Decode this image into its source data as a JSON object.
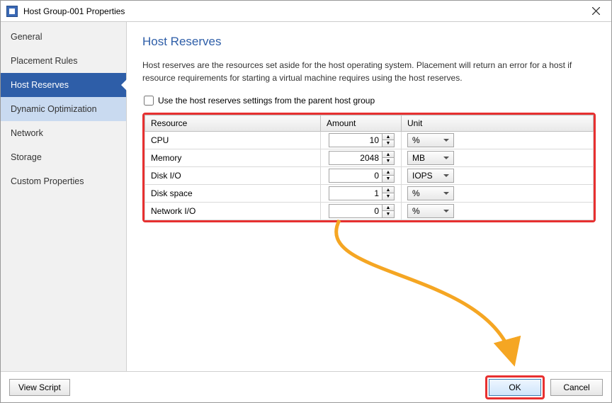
{
  "window": {
    "title": "Host Group-001 Properties"
  },
  "sidebar": {
    "items": [
      {
        "label": "General"
      },
      {
        "label": "Placement Rules"
      },
      {
        "label": "Host Reserves"
      },
      {
        "label": "Dynamic Optimization"
      },
      {
        "label": "Network"
      },
      {
        "label": "Storage"
      },
      {
        "label": "Custom Properties"
      }
    ],
    "selected_index": 2,
    "highlight_index": 3
  },
  "page": {
    "title": "Host Reserves",
    "description": "Host reserves are the resources set aside for the host operating system.  Placement will return an error for a host if resource requirements for starting a virtual machine requires using the host reserves.",
    "checkbox_label": "Use the host reserves settings from the parent host group",
    "checkbox_checked": false,
    "columns": {
      "resource": "Resource",
      "amount": "Amount",
      "unit": "Unit"
    },
    "rows": [
      {
        "resource": "CPU",
        "amount": "10",
        "unit": "%"
      },
      {
        "resource": "Memory",
        "amount": "2048",
        "unit": "MB"
      },
      {
        "resource": "Disk I/O",
        "amount": "0",
        "unit": "IOPS"
      },
      {
        "resource": "Disk space",
        "amount": "1",
        "unit": "%"
      },
      {
        "resource": "Network I/O",
        "amount": "0",
        "unit": "%"
      }
    ]
  },
  "footer": {
    "view_script": "View Script",
    "ok": "OK",
    "cancel": "Cancel"
  }
}
